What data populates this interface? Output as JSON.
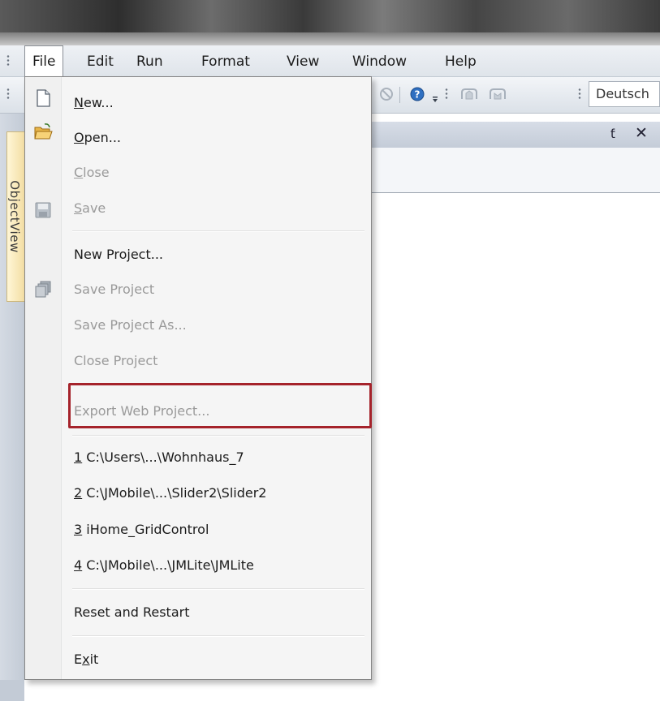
{
  "menubar": {
    "items": [
      {
        "label": "File"
      },
      {
        "label": "Edit"
      },
      {
        "label": "Run"
      },
      {
        "label": "Format"
      },
      {
        "label": "View"
      },
      {
        "label": "Window"
      },
      {
        "label": "Help"
      }
    ]
  },
  "toolbar": {
    "language_value": "Deutsch"
  },
  "side_tab": {
    "label": "ObjectView"
  },
  "panel": {
    "pin_icon": "pin-icon",
    "close_icon": "close-icon"
  },
  "file_menu": {
    "items": [
      {
        "label_accel": "N",
        "label_rest": "ew...",
        "enabled": true,
        "icon": "new-document-icon"
      },
      {
        "label_accel": "O",
        "label_rest": "pen...",
        "enabled": true,
        "icon": "open-folder-icon"
      },
      {
        "label_accel": "C",
        "label_rest": "lose",
        "enabled": false
      },
      {
        "label_accel": "S",
        "label_rest": "ave",
        "enabled": false,
        "icon": "save-icon"
      },
      {
        "label": "New Project...",
        "enabled": true
      },
      {
        "label": "Save Project",
        "enabled": false,
        "icon": "save-project-icon"
      },
      {
        "label": "Save Project As...",
        "enabled": false
      },
      {
        "label": "Close Project",
        "enabled": false
      },
      {
        "label": "Export Web Project...",
        "enabled": false,
        "highlighted": true
      },
      {
        "accel": "1",
        "label": " C:\\Users\\...\\Wohnhaus_7",
        "enabled": true
      },
      {
        "accel": "2",
        "label": " C:\\JMobile\\...\\Slider2\\Slider2",
        "enabled": true
      },
      {
        "accel": "3",
        "label": " iHome_GridControl",
        "enabled": true
      },
      {
        "accel": "4",
        "label": " C:\\JMobile\\...\\JMLite\\JMLite",
        "enabled": true
      },
      {
        "label": "Reset and Restart",
        "enabled": true
      },
      {
        "label_pre": "E",
        "label_accel": "x",
        "label_rest": "it",
        "enabled": true
      }
    ]
  },
  "colors": {
    "highlight_border": "#a5232b",
    "disabled_text": "#9a9a9a"
  }
}
